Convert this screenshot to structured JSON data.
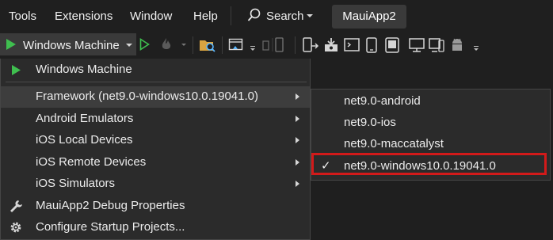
{
  "menubar": {
    "items": [
      "Tools",
      "Extensions",
      "Window",
      "Help"
    ],
    "search_label": "Search",
    "app_title": "MauiApp2"
  },
  "toolbar": {
    "run_target": "Windows Machine",
    "icons": [
      "play-icon",
      "dropdown-caret",
      "start-without-debug-icon",
      "hot-reload-icon",
      "folder-search-icon",
      "browser-icon",
      "device-icons"
    ]
  },
  "debug_menu": {
    "items": [
      {
        "label": "Windows Machine",
        "icon": "play-icon",
        "submenu": false
      },
      {
        "label": "Framework (net9.0-windows10.0.19041.0)",
        "submenu": true,
        "highlighted": true
      },
      {
        "label": "Android Emulators",
        "submenu": true
      },
      {
        "label": "iOS Local Devices",
        "submenu": true
      },
      {
        "label": "iOS Remote Devices",
        "submenu": true
      },
      {
        "label": "iOS Simulators",
        "submenu": true
      },
      {
        "label": "MauiApp2 Debug Properties",
        "icon": "wrench-icon",
        "submenu": false
      },
      {
        "label": "Configure Startup Projects...",
        "icon": "gear-icon",
        "submenu": false
      }
    ]
  },
  "framework_submenu": {
    "items": [
      {
        "label": "net9.0-android",
        "checked": false
      },
      {
        "label": "net9.0-ios",
        "checked": false
      },
      {
        "label": "net9.0-maccatalyst",
        "checked": false
      },
      {
        "label": "net9.0-windows10.0.19041.0",
        "checked": true
      }
    ],
    "check_mark": "✓"
  },
  "colors": {
    "background": "#1f1f1f",
    "menu": "#2b2b2b",
    "highlight": "#3d3d3d",
    "play_green": "#3fbf4f",
    "callout_red": "#d21a1a"
  }
}
